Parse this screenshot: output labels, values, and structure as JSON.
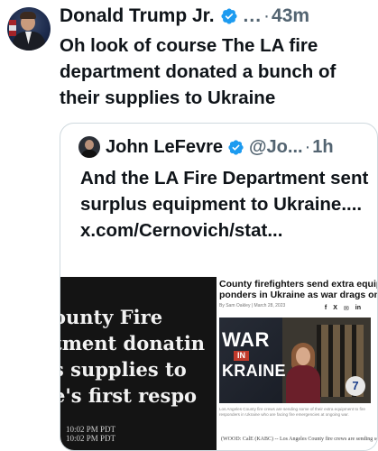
{
  "post": {
    "author_name": "Donald Trump Jr.",
    "handle": "...",
    "separator": "·",
    "time": "43m",
    "text": "Oh look of course The LA fire department donated a bunch of their supplies to Ukraine"
  },
  "quoted_post": {
    "author_name": "John LeFevre",
    "handle": "@Jo...",
    "separator": "·",
    "time": "1h",
    "text": "And the LA Fire Department sent surplus equipment to Ukraine.... x.com/Cernovich/stat...",
    "media_left": {
      "headline_lines": [
        "ounty Fire",
        "tment donatin",
        "s supplies to",
        "e's first respo"
      ],
      "timestamp_lines": [
        "10:02 PM PDT",
        "10:02 PM PDT"
      ]
    },
    "media_right": {
      "headline_lines": [
        "County firefighters send extra equipment to fir",
        "ponders in Ukraine as war drags on"
      ],
      "byline": "By Sam Oakley | March 28, 2023",
      "share_icons": [
        "f",
        "X",
        "✉",
        "in",
        "🔗"
      ],
      "video_title_top": "WAR",
      "video_title_in": "IN",
      "video_title_bottom": "KRAINE",
      "channel_logo": "7",
      "caption": "Los Angeles County fire crews are sending some of their extra equipment to fire responders in Ukraine who are facing fire emergencies at ongoing war.",
      "body_text": "(WOOD: CalE (KABC) -- Los Angeles County fire crews are sending some of"
    }
  },
  "colors": {
    "text_primary": "#0f1419",
    "text_secondary": "#536471",
    "verified_blue": "#1d9bf0",
    "border": "#cfd9de"
  }
}
